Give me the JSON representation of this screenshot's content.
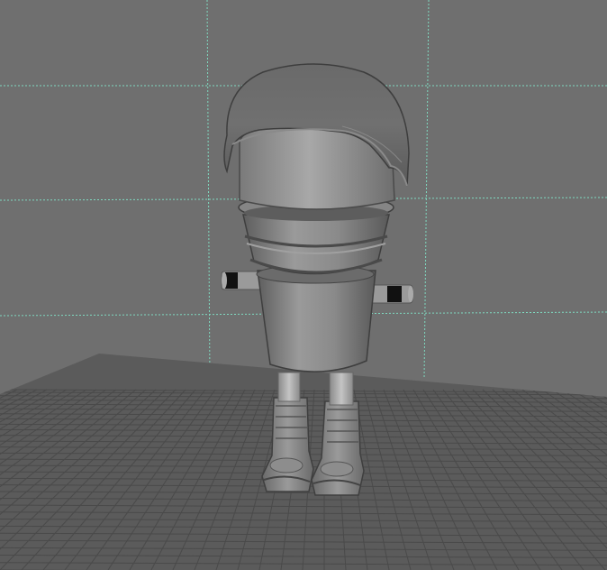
{
  "viewport": {
    "name": "3d-modeling-viewport",
    "background_color": "#6f6f6f",
    "floor_color": "#5b5b5b",
    "floor_grid_color": "#4a4a4a",
    "backdrop_grid_color": "#7fd9c0"
  },
  "model": {
    "name": "capsule-robot-character",
    "body_color": "#8e8e8e",
    "shadow_color": "#4e4e4e",
    "highlight_color": "#b0b0b0",
    "arm_band_color": "#111111",
    "parts": [
      "helmet",
      "head-dome",
      "collar-rings",
      "torso-cone",
      "left-arm",
      "right-arm",
      "left-leg",
      "right-leg",
      "left-boot",
      "right-boot"
    ]
  }
}
